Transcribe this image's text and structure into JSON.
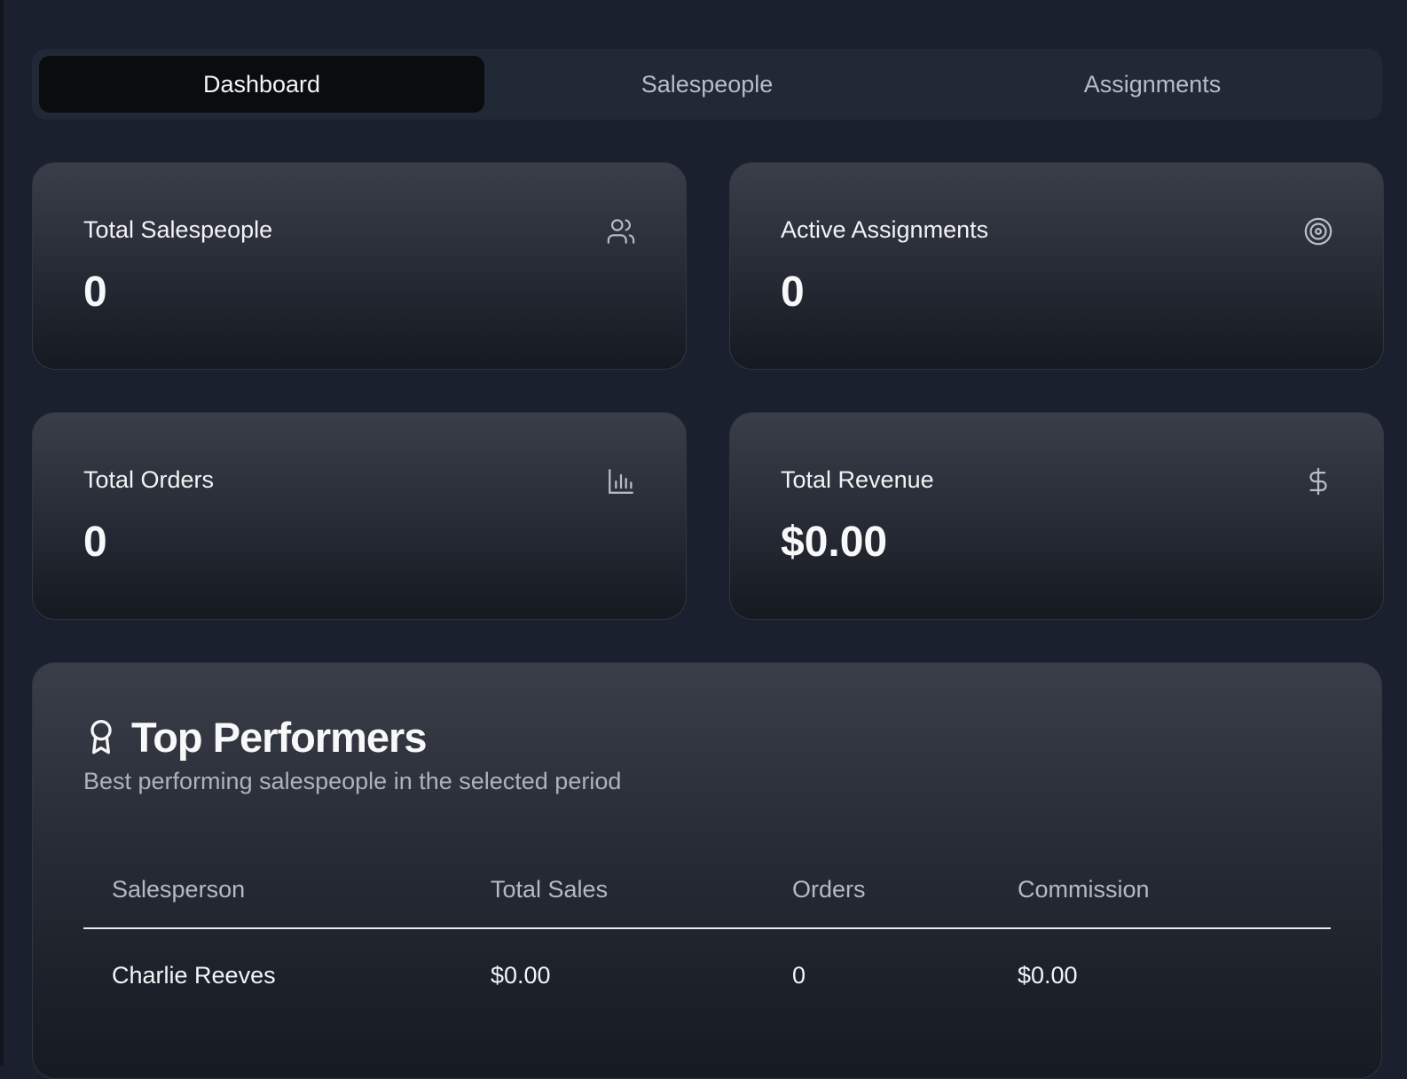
{
  "tabs": [
    {
      "label": "Dashboard",
      "active": true
    },
    {
      "label": "Salespeople",
      "active": false
    },
    {
      "label": "Assignments",
      "active": false
    }
  ],
  "stats": {
    "total_salespeople": {
      "label": "Total Salespeople",
      "value": "0",
      "icon": "users-icon"
    },
    "active_assignments": {
      "label": "Active Assignments",
      "value": "0",
      "icon": "target-icon"
    },
    "total_orders": {
      "label": "Total Orders",
      "value": "0",
      "icon": "bar-chart-icon"
    },
    "total_revenue": {
      "label": "Total Revenue",
      "value": "$0.00",
      "icon": "dollar-icon"
    }
  },
  "top_performers": {
    "title": "Top Performers",
    "subtitle": "Best performing salespeople in the selected period",
    "icon": "award-icon",
    "columns": [
      "Salesperson",
      "Total Sales",
      "Orders",
      "Commission"
    ],
    "rows": [
      {
        "salesperson": "Charlie Reeves",
        "total_sales": "$0.00",
        "orders": "0",
        "commission": "$0.00"
      }
    ]
  },
  "colors": {
    "background": "#1a202d",
    "tab_active": "#0b0c0e",
    "tab_bar": "#212836"
  }
}
